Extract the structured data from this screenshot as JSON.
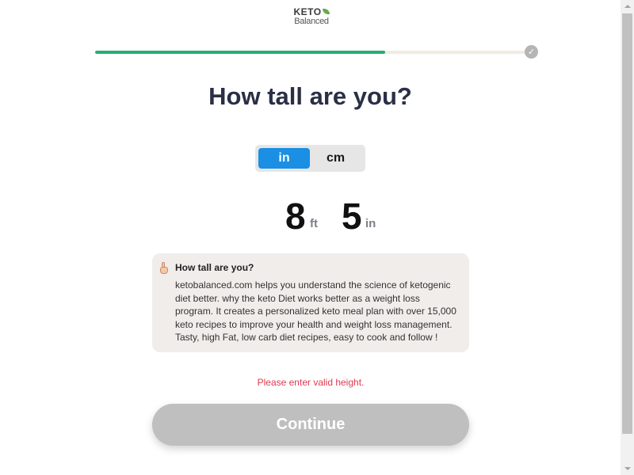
{
  "logo": {
    "line1": "KETO",
    "line2": "Balanced"
  },
  "progress": {
    "fraction": 0.67,
    "fill_color": "#27ae72",
    "complete_icon": "check-icon",
    "check_glyph": "✓"
  },
  "page_title": "How tall are you?",
  "unit_toggle": {
    "options": [
      {
        "label": "in",
        "selected": true
      },
      {
        "label": "cm",
        "selected": false
      }
    ],
    "active_color": "#1a8fe3"
  },
  "height": {
    "feet": "8",
    "feet_unit": "ft",
    "inches": "5",
    "inches_unit": "in"
  },
  "info": {
    "icon": "pointing-hand-icon",
    "title": "How tall are you?",
    "text": "ketobalanced.com helps you understand the science of ketogenic diet better. why the keto Diet works better as a weight loss program. It creates a personalized keto meal plan with over 15,000 keto recipes to improve your health and weight loss management. Tasty, high Fat, low carb diet recipes, easy to cook and follow !"
  },
  "error": {
    "message": "Please enter valid height.",
    "color": "#e0394d"
  },
  "continue_button": {
    "label": "Continue"
  }
}
